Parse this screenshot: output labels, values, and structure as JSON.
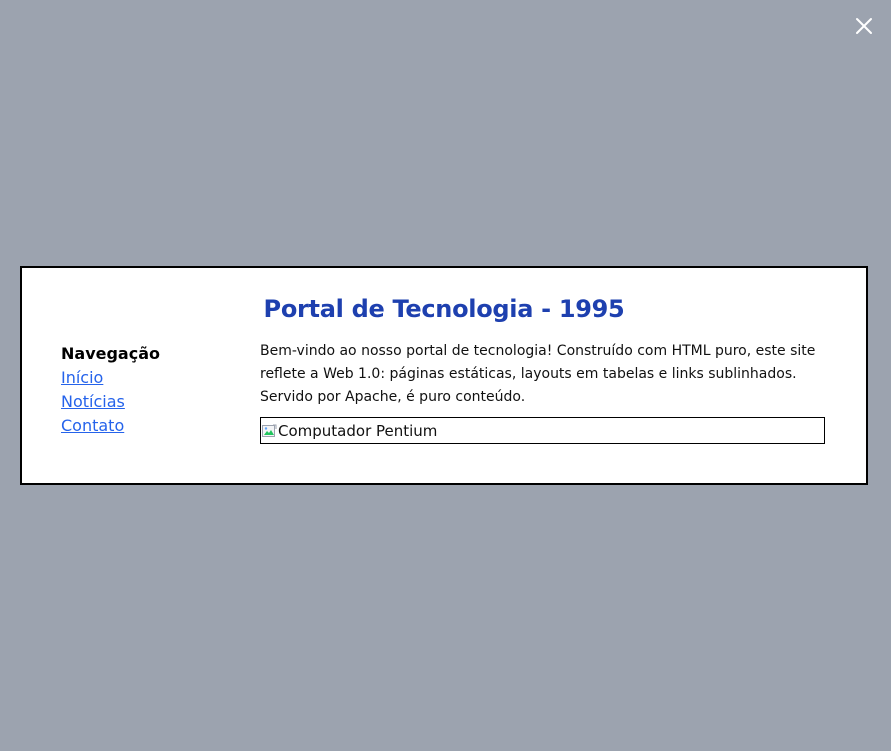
{
  "overlay": {
    "close_icon": "close-icon"
  },
  "modal": {
    "title": "Portal de Tecnologia - 1995",
    "nav": {
      "heading": "Navegação",
      "links": [
        "Início",
        "Notícias",
        "Contato"
      ]
    },
    "content": {
      "paragraph": "Bem-vindo ao nosso portal de tecnologia! Construído com HTML puro, este site reflete a Web 1.0: páginas estáticas, layouts em tabelas e links sublinhados. Servido por Apache, é puro conteúdo.",
      "image_alt": "Computador Pentium",
      "image_icon": "broken-image-icon"
    }
  },
  "colors": {
    "overlay_background": "#9ca3af",
    "title": "#1e40af",
    "link": "#2563eb",
    "modal_border": "#000000"
  }
}
